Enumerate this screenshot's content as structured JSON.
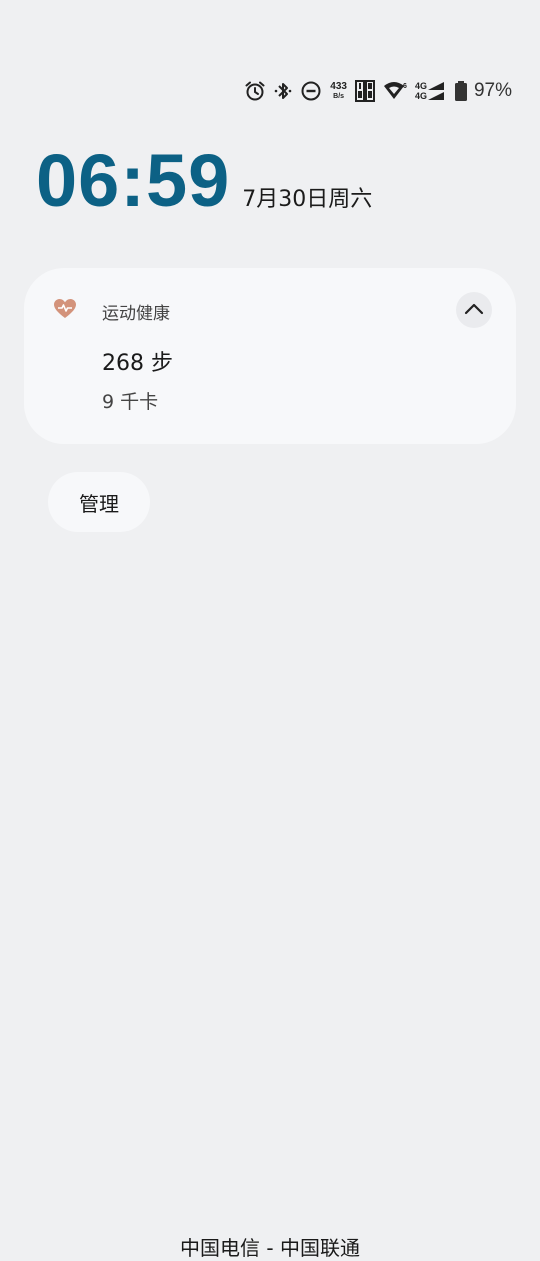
{
  "status_bar": {
    "icons": [
      "alarm-icon",
      "bluetooth-icon",
      "do-not-disturb-icon",
      "sim-card-icon",
      "wifi-icon",
      "signal-icon",
      "battery-icon"
    ],
    "net_speed_value": "433",
    "net_speed_unit": "B/s",
    "net_type_1": "4G",
    "net_type_2": "4G",
    "battery_percent": "97%"
  },
  "clock": {
    "time": "06:59",
    "date": "7月30日周六"
  },
  "health_card": {
    "app_name": "运动健康",
    "steps": "268 步",
    "calories": "9 千卡",
    "accent_color": "#d3937b"
  },
  "manage_label": "管理",
  "carrier_text": "中国电信 - 中国联通",
  "colors": {
    "clock": "#0c6185",
    "background": "#eff0f2",
    "card": "#f7f8fa"
  }
}
